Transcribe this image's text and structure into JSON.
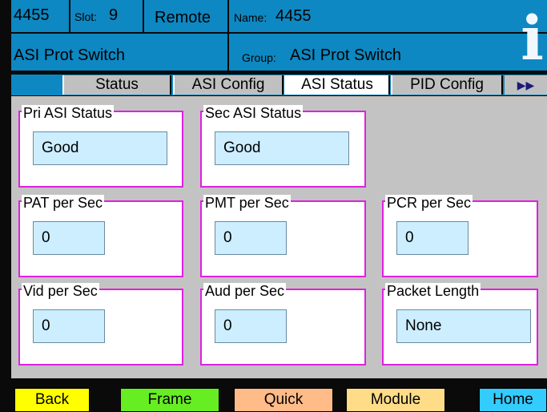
{
  "header": {
    "id": "4455",
    "slot_label": "Slot:",
    "slot_value": "9",
    "mode": "Remote",
    "name_label": "Name:",
    "name_value": "4455",
    "card_title": "ASI Prot Switch",
    "group_label": "Group:",
    "group_value": "ASI Prot Switch",
    "info_icon": "i"
  },
  "tabs": [
    {
      "label": "Status"
    },
    {
      "label": "ASI Config"
    },
    {
      "label": "ASI Status",
      "active": true
    },
    {
      "label": "PID Config"
    }
  ],
  "tab_more": "▶▶",
  "groups": {
    "pri_asi": {
      "label": "Pri ASI Status",
      "value": "Good"
    },
    "sec_asi": {
      "label": "Sec ASI Status",
      "value": "Good"
    },
    "pat": {
      "label": "PAT per Sec",
      "value": "0"
    },
    "pmt": {
      "label": "PMT per Sec",
      "value": "0"
    },
    "pcr": {
      "label": "PCR per Sec",
      "value": "0"
    },
    "vid": {
      "label": "Vid per Sec",
      "value": "0"
    },
    "aud": {
      "label": "Aud per Sec",
      "value": "0"
    },
    "pkt": {
      "label": "Packet Length",
      "value": "None"
    }
  },
  "footer": {
    "back": "Back",
    "frame": "Frame",
    "quick": "Quick",
    "module": "Module",
    "home": "Home"
  },
  "colors": {
    "header_blue": "#0d88c2",
    "group_border": "#e020e0",
    "value_bg": "#cceeff",
    "back": "#ffff00",
    "frame": "#66ee22",
    "quick": "#ffbb88",
    "module": "#ffdd88",
    "home": "#33ccff"
  }
}
